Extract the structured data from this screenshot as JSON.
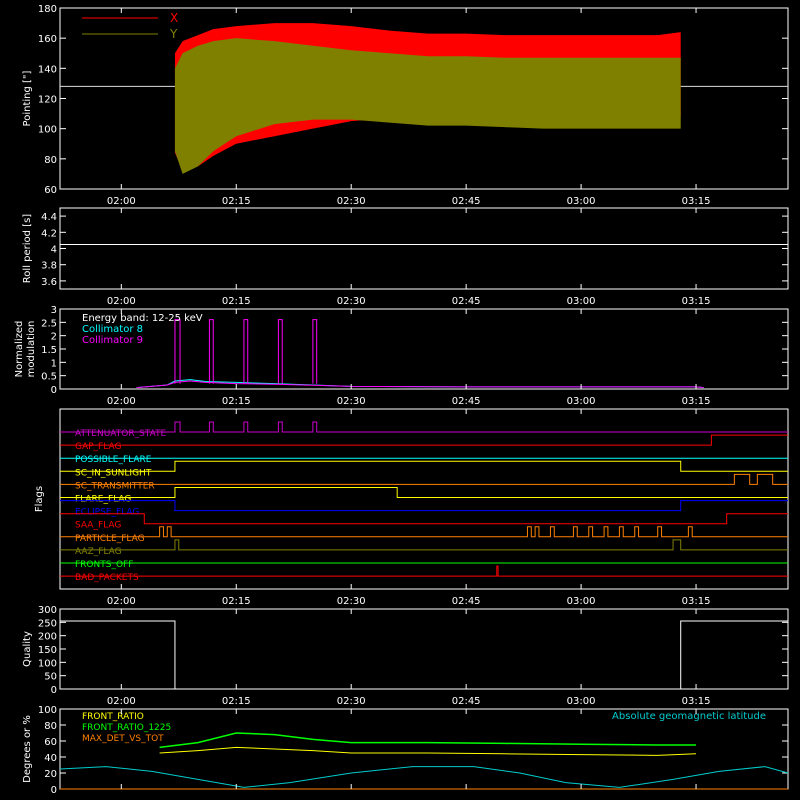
{
  "time_ticks": [
    "02:00",
    "02:15",
    "02:30",
    "02:45",
    "03:00",
    "03:15"
  ],
  "chart_data": [
    {
      "type": "line",
      "panel": "pointing",
      "ylabel": "Pointing [\"]",
      "ylim": [
        60,
        180
      ],
      "yticks": [
        60,
        80,
        100,
        120,
        140,
        160,
        180
      ],
      "xlim": [
        "01:52",
        "03:27"
      ],
      "legend": [
        "X",
        "Y"
      ],
      "legend_position": "top-left",
      "reference_line": 128,
      "data_span": [
        "02:07",
        "03:13"
      ],
      "series": [
        {
          "name": "X",
          "color": "#ff0000",
          "x": [
            "02:07",
            "02:08",
            "02:10",
            "02:12",
            "02:15",
            "02:20",
            "02:25",
            "02:30",
            "02:35",
            "02:40",
            "02:45",
            "02:50",
            "02:55",
            "03:00",
            "03:05",
            "03:10",
            "03:13"
          ],
          "upper": [
            150,
            158,
            162,
            166,
            168,
            170,
            170,
            168,
            165,
            163,
            163,
            162,
            162,
            162,
            162,
            162,
            164
          ],
          "lower": [
            84,
            72,
            75,
            82,
            90,
            95,
            100,
            105,
            107,
            108,
            108,
            108,
            108,
            108,
            108,
            108,
            108
          ]
        },
        {
          "name": "Y",
          "color": "#808000",
          "x": [
            "02:07",
            "02:08",
            "02:10",
            "02:12",
            "02:15",
            "02:20",
            "02:25",
            "02:30",
            "02:35",
            "02:40",
            "02:45",
            "02:50",
            "02:55",
            "03:00",
            "03:05",
            "03:10",
            "03:13"
          ],
          "upper": [
            140,
            150,
            155,
            158,
            160,
            158,
            155,
            152,
            150,
            148,
            148,
            147,
            147,
            147,
            147,
            147,
            147
          ],
          "lower": [
            85,
            70,
            75,
            85,
            95,
            103,
            106,
            106,
            104,
            102,
            102,
            101,
            100,
            100,
            100,
            100,
            100
          ]
        }
      ]
    },
    {
      "type": "line",
      "panel": "roll_period",
      "ylabel": "Roll period [s]",
      "ylim": [
        3.5,
        4.5
      ],
      "yticks": [
        3.6,
        3.8,
        4.0,
        4.2,
        4.4
      ],
      "xlim": [
        "01:52",
        "03:27"
      ],
      "series": [
        {
          "name": "",
          "color": "#ffffff",
          "x": [
            "01:52",
            "03:27"
          ],
          "y": [
            4.05,
            4.05
          ]
        }
      ]
    },
    {
      "type": "line",
      "panel": "modulation",
      "ylabel": "Normalized modulation",
      "ylim": [
        0,
        3.0
      ],
      "yticks": [
        0.0,
        0.5,
        1.0,
        1.5,
        2.0,
        2.5,
        3.0
      ],
      "xlim": [
        "01:52",
        "03:27"
      ],
      "legend": [
        "Energy band: 12-25 keV",
        "Collimator 8",
        "Collimator 9"
      ],
      "legend_position": "top-left",
      "series": [
        {
          "name": "Collimator 8",
          "color": "#00ffff",
          "x": [
            "02:02",
            "02:06",
            "02:07",
            "02:09",
            "02:11",
            "02:15",
            "02:20",
            "02:25",
            "02:30",
            "02:45",
            "03:00",
            "03:15",
            "03:16"
          ],
          "y": [
            0.05,
            0.15,
            0.3,
            0.35,
            0.28,
            0.25,
            0.2,
            0.15,
            0.1,
            0.08,
            0.08,
            0.08,
            0.05
          ]
        },
        {
          "name": "Collimator 9",
          "color": "#ff00ff",
          "x": [
            "02:02",
            "02:06",
            "02:07",
            "02:09",
            "02:11",
            "02:15",
            "02:20",
            "02:25",
            "02:30",
            "02:45",
            "03:00",
            "03:15",
            "03:16"
          ],
          "y": [
            0.05,
            0.15,
            0.25,
            0.3,
            0.25,
            0.2,
            0.18,
            0.14,
            0.1,
            0.08,
            0.08,
            0.08,
            0.05
          ]
        }
      ],
      "spikes": {
        "color": "#ff00ff",
        "height": 2.6,
        "intervals": [
          [
            "02:07",
            "02:07:40"
          ],
          [
            "02:11:30",
            "02:12"
          ],
          [
            "02:16",
            "02:16:30"
          ],
          [
            "02:20:30",
            "02:21"
          ],
          [
            "02:25",
            "02:25:30"
          ]
        ]
      }
    },
    {
      "type": "line",
      "panel": "flags",
      "ylabel": "Flags",
      "xlim": [
        "01:52",
        "03:27"
      ],
      "flags": [
        {
          "name": "ATTENUATOR_STATE",
          "color": "#cc00cc",
          "segments": [
            [
              "01:52",
              0
            ],
            [
              "02:07",
              1
            ],
            [
              "02:07:40",
              0
            ],
            [
              "02:11:30",
              1
            ],
            [
              "02:12",
              0
            ],
            [
              "02:16",
              1
            ],
            [
              "02:16:30",
              0
            ],
            [
              "02:20:30",
              1
            ],
            [
              "02:21",
              0
            ],
            [
              "02:25",
              1
            ],
            [
              "02:25:30",
              0
            ],
            [
              "03:27",
              0
            ]
          ]
        },
        {
          "name": "GAP_FLAG",
          "color": "#ff0000",
          "segments": [
            [
              "01:52",
              0
            ],
            [
              "03:17",
              1
            ],
            [
              "03:27",
              1
            ]
          ]
        },
        {
          "name": "POSSIBLE_FLARE",
          "color": "#00ffff",
          "segments": [
            [
              "01:52",
              0
            ],
            [
              "03:27",
              0
            ]
          ]
        },
        {
          "name": "SC_IN_SUNLIGHT",
          "color": "#ffff00",
          "segments": [
            [
              "01:52",
              0
            ],
            [
              "02:07",
              1
            ],
            [
              "03:13",
              0
            ],
            [
              "03:27",
              0
            ]
          ]
        },
        {
          "name": "SC_TRANSMITTER",
          "color": "#ff8000",
          "segments": [
            [
              "01:52",
              0
            ],
            [
              "03:20",
              1
            ],
            [
              "03:22",
              0
            ],
            [
              "03:23",
              1
            ],
            [
              "03:25",
              0
            ],
            [
              "03:27",
              0
            ]
          ]
        },
        {
          "name": "FLARE_FLAG",
          "color": "#ffff00",
          "segments": [
            [
              "01:52",
              0
            ],
            [
              "02:07",
              1
            ],
            [
              "02:36",
              0
            ],
            [
              "03:27",
              0
            ]
          ]
        },
        {
          "name": "ECLIPSE_FLAG",
          "color": "#0000ff",
          "segments": [
            [
              "01:52",
              1
            ],
            [
              "02:07",
              0
            ],
            [
              "03:13",
              1
            ],
            [
              "03:27",
              1
            ]
          ]
        },
        {
          "name": "SAA_FLAG",
          "color": "#ff0000",
          "segments": [
            [
              "01:52",
              1
            ],
            [
              "02:03",
              0
            ],
            [
              "03:19",
              1
            ],
            [
              "03:27",
              1
            ]
          ]
        },
        {
          "name": "PARTICLE_FLAG",
          "color": "#ff8000",
          "segments": [
            [
              "01:52",
              0
            ],
            [
              "02:05",
              1
            ],
            [
              "02:05:30",
              0
            ],
            [
              "02:06",
              1
            ],
            [
              "02:06:30",
              0
            ],
            [
              "02:53",
              1
            ],
            [
              "02:53:30",
              0
            ],
            [
              "02:54",
              1
            ],
            [
              "02:54:30",
              0
            ],
            [
              "02:56",
              1
            ],
            [
              "02:56:30",
              0
            ],
            [
              "02:59",
              1
            ],
            [
              "02:59:30",
              0
            ],
            [
              "03:01",
              1
            ],
            [
              "03:01:30",
              0
            ],
            [
              "03:03",
              1
            ],
            [
              "03:03:30",
              0
            ],
            [
              "03:05",
              1
            ],
            [
              "03:05:30",
              0
            ],
            [
              "03:07",
              1
            ],
            [
              "03:07:30",
              0
            ],
            [
              "03:10",
              1
            ],
            [
              "03:10:30",
              0
            ],
            [
              "03:14",
              1
            ],
            [
              "03:14:30",
              0
            ],
            [
              "03:27",
              0
            ]
          ]
        },
        {
          "name": "AAZ_FLAG",
          "color": "#808000",
          "segments": [
            [
              "01:52",
              0
            ],
            [
              "02:07",
              1
            ],
            [
              "02:07:30",
              0
            ],
            [
              "03:12",
              1
            ],
            [
              "03:13",
              0
            ],
            [
              "03:27",
              0
            ]
          ]
        },
        {
          "name": "FRONTS_OFF",
          "color": "#00ff00",
          "segments": [
            [
              "01:52",
              0
            ],
            [
              "03:27",
              0
            ]
          ]
        },
        {
          "name": "BAD_PACKETS",
          "color": "#ff0000",
          "segments": [
            [
              "01:52",
              0
            ],
            [
              "02:49",
              1
            ],
            [
              "02:49:10",
              0
            ],
            [
              "03:27",
              0
            ]
          ]
        }
      ]
    },
    {
      "type": "line",
      "panel": "quality",
      "ylabel": "Quality",
      "ylim": [
        0,
        300
      ],
      "yticks": [
        0,
        50,
        100,
        150,
        200,
        250,
        300
      ],
      "xlim": [
        "01:52",
        "03:27"
      ],
      "series": [
        {
          "name": "",
          "color": "#ffffff",
          "x": [
            "01:52",
            "02:07",
            "02:07",
            "03:13",
            "03:13",
            "03:27"
          ],
          "y": [
            255,
            255,
            0,
            0,
            255,
            255
          ]
        }
      ]
    },
    {
      "type": "line",
      "panel": "degrees",
      "ylabel": "Degrees or %",
      "ylim": [
        0,
        100
      ],
      "yticks": [
        0,
        20,
        40,
        60,
        80,
        100
      ],
      "xlim": [
        "01:52",
        "03:27"
      ],
      "legend": [
        "FRONT_RATIO",
        "FRONT_RATIO_1225",
        "MAX_DET_VS_TOT"
      ],
      "legend_position": "top-left",
      "right_label": "Absolute geomagnetic latitude",
      "series": [
        {
          "name": "FRONT_RATIO",
          "color": "#ffff00",
          "x": [
            "02:05",
            "02:10",
            "02:15",
            "02:20",
            "02:25",
            "02:30",
            "02:40",
            "02:50",
            "03:00",
            "03:10",
            "03:15"
          ],
          "y": [
            45,
            48,
            52,
            50,
            48,
            45,
            45,
            44,
            43,
            42,
            44
          ]
        },
        {
          "name": "FRONT_RATIO_1225",
          "color": "#00ff00",
          "x": [
            "02:05",
            "02:10",
            "02:15",
            "02:20",
            "02:25",
            "02:30",
            "02:40",
            "02:50",
            "03:00",
            "03:10",
            "03:15"
          ],
          "y": [
            52,
            58,
            70,
            68,
            62,
            58,
            58,
            57,
            56,
            55,
            55
          ]
        },
        {
          "name": "MAX_DET_VS_TOT",
          "color": "#ff8000",
          "x": [
            "01:52",
            "03:27"
          ],
          "y": [
            0,
            0
          ]
        },
        {
          "name": "Absolute geomagnetic latitude",
          "color": "#00cccc",
          "x": [
            "01:52",
            "01:58",
            "02:04",
            "02:10",
            "02:16",
            "02:22",
            "02:30",
            "02:38",
            "02:46",
            "02:52",
            "02:58",
            "03:05",
            "03:12",
            "03:18",
            "03:24",
            "03:27"
          ],
          "y": [
            25,
            28,
            22,
            12,
            2,
            8,
            20,
            28,
            28,
            20,
            8,
            2,
            12,
            22,
            28,
            20
          ]
        }
      ]
    }
  ]
}
